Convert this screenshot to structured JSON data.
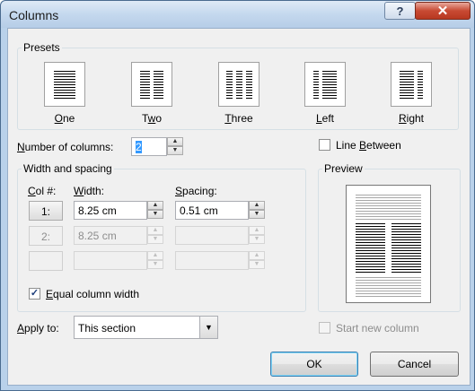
{
  "window": {
    "title": "Columns",
    "help_glyph": "?",
    "close_glyph": "✕"
  },
  "presets": {
    "label": "Presets",
    "items": [
      {
        "name": "one",
        "label": "One",
        "mnemonic": "O",
        "rest": "ne"
      },
      {
        "name": "two",
        "label": "Two",
        "mnemonic": "w",
        "pre": "T",
        "rest": "o"
      },
      {
        "name": "three",
        "label": "Three",
        "mnemonic": "T",
        "rest": "hree"
      },
      {
        "name": "left",
        "label": "Left",
        "mnemonic": "L",
        "rest": "eft"
      },
      {
        "name": "right",
        "label": "Right",
        "mnemonic": "R",
        "rest": "ight"
      }
    ]
  },
  "num_columns": {
    "label_pre": "",
    "mnemonic": "N",
    "label_rest": "umber of columns:",
    "value": "2"
  },
  "line_between": {
    "mnemonic": "B",
    "pre": "Line ",
    "rest": "etween",
    "checked": false
  },
  "width_spacing": {
    "label": "Width and spacing",
    "col_header_pre": "",
    "col_header_mnemonic": "C",
    "col_header_rest": "ol #:",
    "width_header_mnemonic": "W",
    "width_header_rest": "idth:",
    "spacing_header_mnemonic": "S",
    "spacing_header_rest": "pacing:",
    "rows": [
      {
        "col": "1:",
        "width": "8.25 cm",
        "spacing": "0.51 cm",
        "enabled": true
      },
      {
        "col": "2:",
        "width": "8.25 cm",
        "spacing": "",
        "enabled": false
      },
      {
        "col": "",
        "width": "",
        "spacing": "",
        "enabled": false
      }
    ]
  },
  "equal_width": {
    "mnemonic": "E",
    "rest": "qual column width",
    "checked": true,
    "check_glyph": "✓"
  },
  "preview": {
    "label": "Preview"
  },
  "apply_to": {
    "mnemonic": "A",
    "rest": "pply to:",
    "value": "This section",
    "arrow": "▼"
  },
  "start_new_column": {
    "label": "Start new column",
    "checked": false,
    "enabled": false
  },
  "buttons": {
    "ok": "OK",
    "cancel": "Cancel"
  },
  "spin_up": "▲",
  "spin_down": "▼"
}
